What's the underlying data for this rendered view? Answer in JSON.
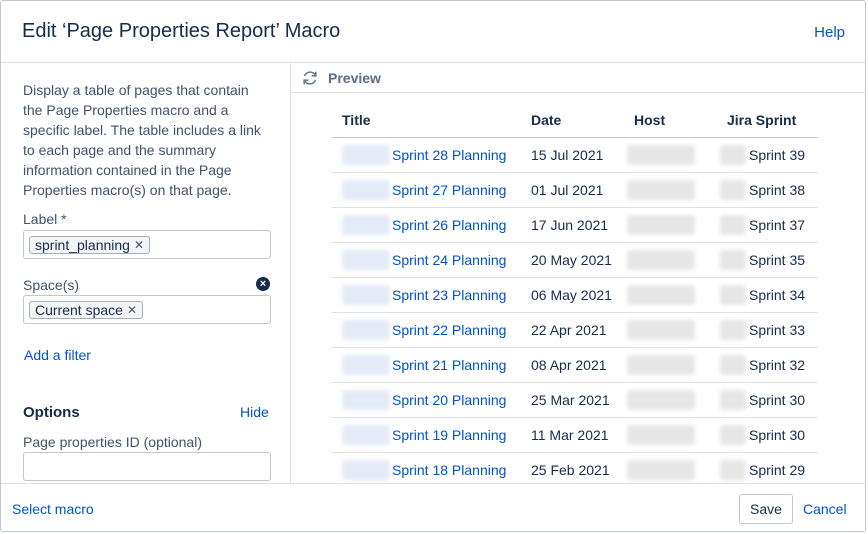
{
  "dialog": {
    "title": "Edit ‘Page Properties Report’ Macro",
    "help_label": "Help"
  },
  "left": {
    "description": "Display a table of pages that contain the Page Properties macro and a specific label. The table includes a link to each page and the summary information contained in the Page Properties macro(s) on that page.",
    "label_field": {
      "label": "Label *",
      "tag": "sprint_planning"
    },
    "space_field": {
      "label": "Space(s)",
      "tag": "Current space"
    },
    "add_filter": "Add a filter",
    "options": {
      "title": "Options",
      "hide_label": "Hide"
    },
    "page_props_id": {
      "label": "Page properties ID (optional)",
      "value": ""
    }
  },
  "preview": {
    "label": "Preview",
    "columns": [
      "Title",
      "Date",
      "Host",
      "Jira Sprint"
    ],
    "rows": [
      {
        "title": "Sprint 28 Planning",
        "date": "15 Jul 2021",
        "sprint": "Sprint 39"
      },
      {
        "title": "Sprint 27 Planning",
        "date": "01 Jul 2021",
        "sprint": "Sprint 38"
      },
      {
        "title": "Sprint 26 Planning",
        "date": "17 Jun 2021",
        "sprint": "Sprint 37"
      },
      {
        "title": "Sprint 24 Planning",
        "date": "20 May 2021",
        "sprint": "Sprint 35"
      },
      {
        "title": "Sprint 23 Planning",
        "date": "06 May 2021",
        "sprint": "Sprint 34"
      },
      {
        "title": "Sprint 22 Planning",
        "date": "22 Apr 2021",
        "sprint": "Sprint 33"
      },
      {
        "title": "Sprint 21 Planning",
        "date": "08 Apr 2021",
        "sprint": "Sprint 32"
      },
      {
        "title": "Sprint 20 Planning",
        "date": "25 Mar 2021",
        "sprint": "Sprint 30"
      },
      {
        "title": "Sprint 19 Planning",
        "date": "11 Mar 2021",
        "sprint": "Sprint 30"
      },
      {
        "title": "Sprint 18 Planning",
        "date": "25 Feb 2021",
        "sprint": "Sprint 29"
      }
    ]
  },
  "footer": {
    "select_macro": "Select macro",
    "save_label": "Save",
    "cancel_label": "Cancel"
  },
  "colors": {
    "link": "#0052cc",
    "text": "#172b4d",
    "border": "#c1c7d0"
  }
}
